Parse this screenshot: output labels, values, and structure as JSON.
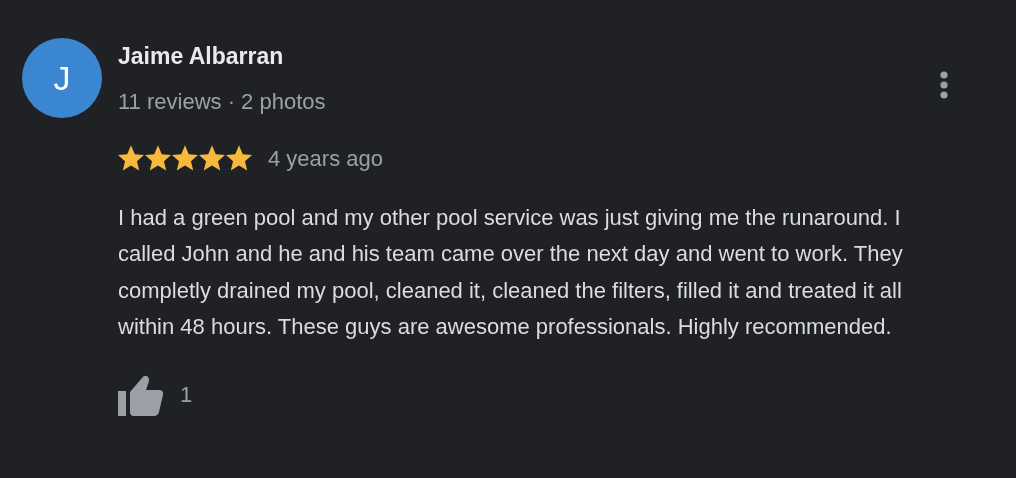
{
  "review": {
    "avatar_letter": "J",
    "author": "Jaime Albarran",
    "author_meta": "11 reviews · 2 photos",
    "stars": 5,
    "time": "4 years ago",
    "text": "I had a green pool and my other pool service was just giving me the runaround. I called John and he and his team came over the next day and went to work. They completly drained my pool, cleaned it, cleaned the filters, filled it and treated it all within 48 hours. These guys are awesome professionals. Highly recommended.",
    "like_count": "1"
  }
}
